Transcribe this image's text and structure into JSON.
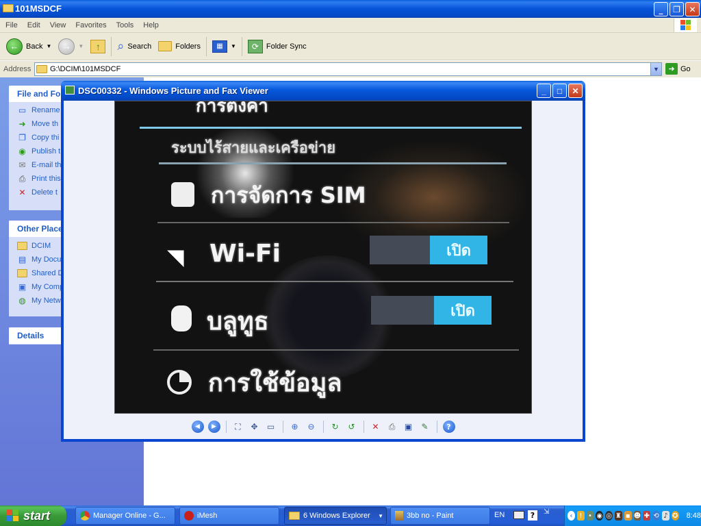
{
  "explorer": {
    "title": "101MSDCF",
    "menu": [
      "File",
      "Edit",
      "View",
      "Favorites",
      "Tools",
      "Help"
    ],
    "toolbar": {
      "back_label": "Back",
      "search_label": "Search",
      "folders_label": "Folders",
      "folder_sync_label": "Folder Sync"
    },
    "address": {
      "label": "Address",
      "value": "G:\\DCIM\\101MSDCF",
      "go_label": "Go"
    },
    "task_pane": {
      "file_tasks_title": "File and Fol",
      "file_tasks": [
        {
          "label": "Rename",
          "icon": "rename-icon"
        },
        {
          "label": "Move th",
          "icon": "move-icon"
        },
        {
          "label": "Copy thi",
          "icon": "copy-icon"
        },
        {
          "label": "Publish t",
          "icon": "publish-web-icon"
        },
        {
          "label": "E-mail th",
          "icon": "email-icon"
        },
        {
          "label": "Print this",
          "icon": "print-icon"
        },
        {
          "label": "Delete t",
          "icon": "delete-icon"
        }
      ],
      "other_places_title": "Other Place",
      "other_places": [
        {
          "label": "DCIM",
          "icon": "folder-icon"
        },
        {
          "label": "My Docu",
          "icon": "my-documents-icon"
        },
        {
          "label": "Shared D",
          "icon": "folder-icon"
        },
        {
          "label": "My Comp",
          "icon": "my-computer-icon"
        },
        {
          "label": "My Netw",
          "icon": "my-network-icon"
        }
      ],
      "details_title": "Details"
    }
  },
  "viewer": {
    "title": "DSC00332 - Windows Picture and Fax Viewer",
    "photo": {
      "header_partial": "การตั้งค่า",
      "section_heading": "ระบบไร้สายและเครือข่าย",
      "sim_label": "การจัดการ SIM",
      "wifi_label": "Wi-Fi",
      "wifi_toggle": "เปิด",
      "bluetooth_label": "บลูทูธ",
      "bluetooth_toggle": "เปิด",
      "data_usage_label": "การใช้ข้อมูล"
    }
  },
  "taskbar": {
    "start_label": "start",
    "buttons": [
      {
        "label": "Manager Online - G...",
        "icon": "chrome-icon"
      },
      {
        "label": "iMesh",
        "icon": "imesh-icon"
      },
      {
        "label": "6 Windows Explorer",
        "icon": "folder-icon"
      },
      {
        "label": "3bb no - Paint",
        "icon": "paint-icon"
      }
    ],
    "language": "EN",
    "clock": "8:48"
  },
  "colors": {
    "xp_blue": "#0653d8",
    "task_pane_blue": "#6f8ce0",
    "start_green": "#3a9a3a",
    "toggle_on": "#31b4e6"
  }
}
